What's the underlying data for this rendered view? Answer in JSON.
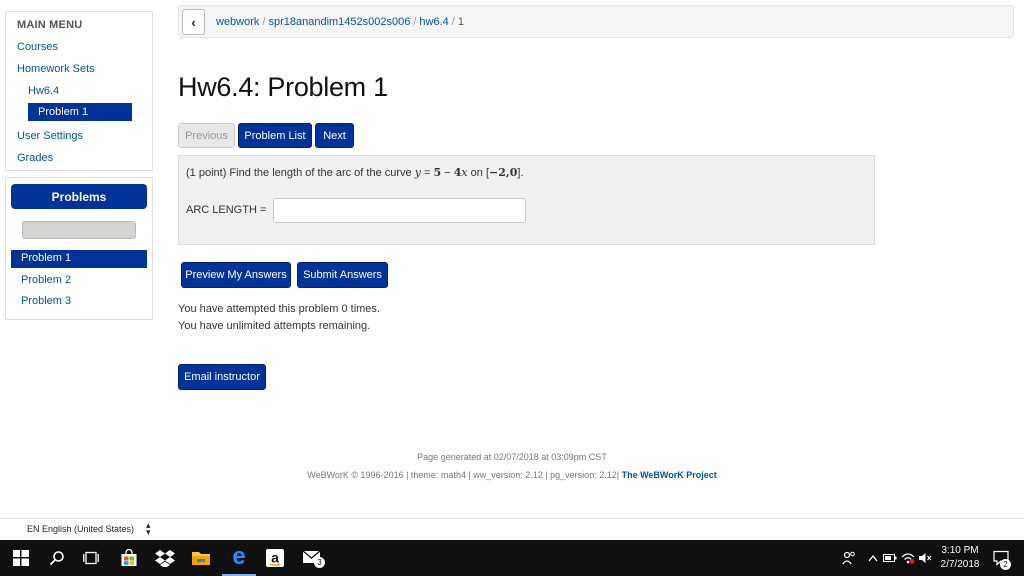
{
  "sidebar": {
    "menu_header": "MAIN MENU",
    "courses": "Courses",
    "homework_sets": "Homework Sets",
    "hw_set": "Hw6.4",
    "problem": "Problem 1",
    "user_settings": "User Settings",
    "grades": "Grades"
  },
  "problems_panel": {
    "heading": "Problems",
    "progress_fraction": 0,
    "items": [
      "Problem 1",
      "Problem 2",
      "Problem 3"
    ],
    "active_index": 0
  },
  "breadcrumb": {
    "back_icon": "chevron-left-icon",
    "items": [
      "webwork",
      "spr18anandim1452s002s006",
      "hw6.4",
      "1"
    ],
    "separator": "/"
  },
  "page_title": "Hw6.4: Problem 1",
  "nav": {
    "previous": "Previous",
    "problem_list": "Problem List",
    "next": "Next"
  },
  "problem": {
    "points": "(1 point)",
    "prompt": "Find the length of the arc of the curve",
    "equation_lhs": "y",
    "equation_eq": "=",
    "equation_const": "5",
    "equation_minus": "−",
    "equation_coef": "4",
    "equation_var": "x",
    "on_word": "on",
    "interval_open": "[",
    "interval_a": "−2",
    "interval_sep": ",",
    "interval_b": "0",
    "interval_close": "]",
    "period": ".",
    "answer_label": "ARC LENGTH",
    "answer_eq": "=",
    "answer_value": ""
  },
  "actions": {
    "preview": "Preview My Answers",
    "submit": "Submit Answers"
  },
  "attempts": {
    "line1": "You have attempted this problem 0 times.",
    "line2": "You have unlimited attempts remaining."
  },
  "email_instructor": "Email instructor",
  "footer": {
    "generated": "Page generated at 02/07/2018 at 03:09pm CST",
    "credits": "WeBWorK © 1996-2016 | theme: math4 | ww_version: 2.12 | pg_version: 2.12|",
    "project_link": "The WeBWorK Project"
  },
  "language": {
    "selected": "EN English (United States)"
  },
  "taskbar": {
    "icons": [
      "windows-icon",
      "search-icon",
      "task-view-icon",
      "store-icon",
      "dropbox-icon",
      "file-explorer-icon",
      "edge-icon",
      "amazon-icon",
      "mail-icon"
    ],
    "mail_badge": "3",
    "time": "3:10 PM",
    "date": "2/7/2018",
    "notification_count": "2"
  },
  "colors": {
    "primary": "#003399",
    "link": "#0055aa",
    "taskbar": "#101010",
    "edge": "#1e90ff",
    "dropbox": "#0061fe"
  }
}
